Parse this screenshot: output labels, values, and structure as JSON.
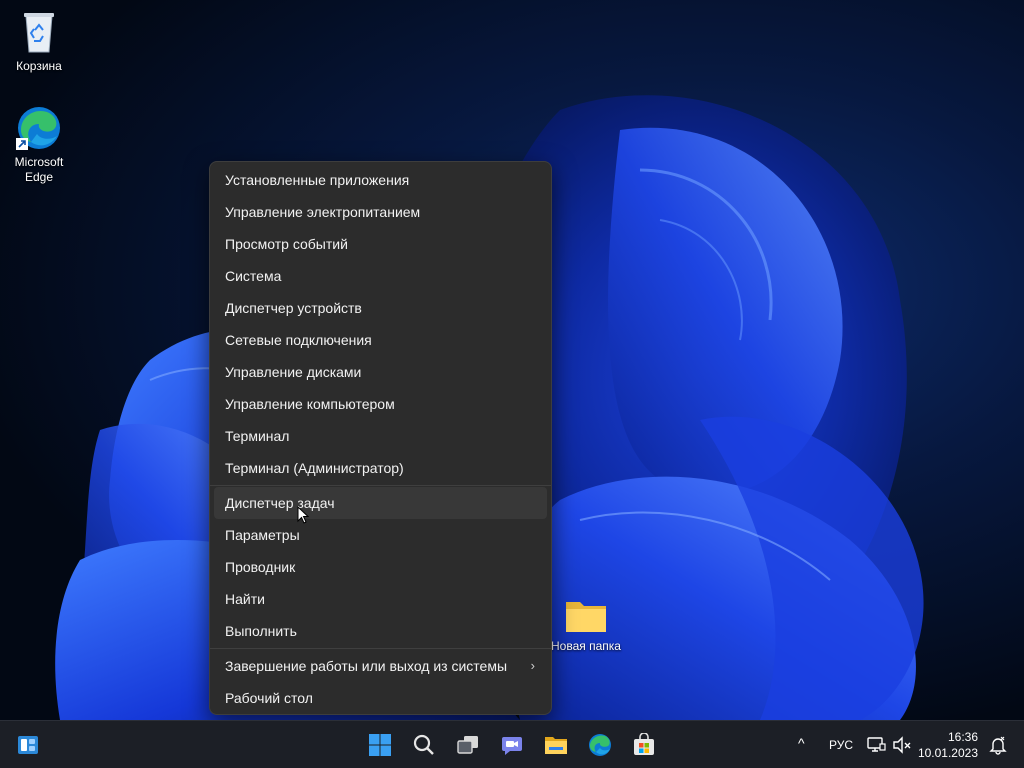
{
  "desktop": {
    "icons": [
      {
        "label": "Корзина"
      },
      {
        "label": "Microsoft\nEdge"
      },
      {
        "label": "Новая папка"
      }
    ]
  },
  "context_menu": {
    "groups": [
      [
        "Установленные приложения",
        "Управление электропитанием",
        "Просмотр событий",
        "Система",
        "Диспетчер устройств",
        "Сетевые подключения",
        "Управление дисками",
        "Управление компьютером",
        "Терминал",
        "Терминал (Администратор)"
      ],
      [
        "Диспетчер задач",
        "Параметры",
        "Проводник",
        "Найти",
        "Выполнить"
      ],
      [
        "Завершение работы или выход из системы",
        "Рабочий стол"
      ]
    ],
    "hovered_item": "Диспетчер задач",
    "submenu_arrow": "›"
  },
  "taskbar": {
    "pinned": [
      "start-icon",
      "search-icon",
      "task-view-icon",
      "chat-icon",
      "file-explorer-icon",
      "edge-icon",
      "store-icon"
    ],
    "tray": {
      "chevron": "^",
      "language": "РУС",
      "time": "16:36",
      "date": "10.01.2023"
    }
  },
  "colors": {
    "menu_bg": "#2c2c2c",
    "menu_hover": "#383838",
    "taskbar_bg": "#1c1f26",
    "accent": "#4cc2ff"
  }
}
